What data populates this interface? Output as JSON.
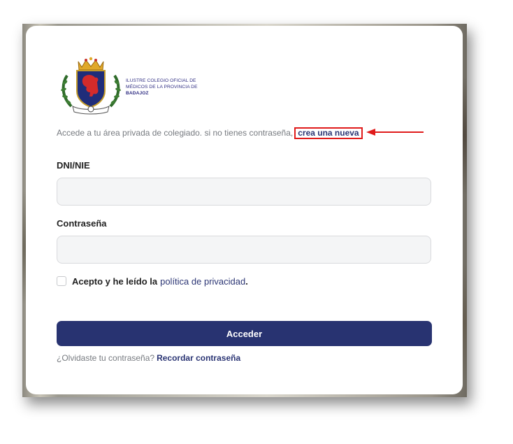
{
  "logo": {
    "line1": "ILUSTRE COLEGIO OFICIAL DE",
    "line2": "MÉDICOS DE LA PROVINCIA DE",
    "line3": "BADAJOZ"
  },
  "intro": {
    "text": "Accede a tu área privada de colegiado. si no tienes contraseña,",
    "create_link": "crea una nueva"
  },
  "form": {
    "dni_label": "DNI/NIE",
    "dni_value": "",
    "password_label": "Contraseña",
    "password_value": "",
    "accept_text": "Acepto y he leído la",
    "policy_link": "política de privacidad",
    "accept_suffix": ".",
    "accept_checked": false,
    "submit_label": "Acceder"
  },
  "forgot": {
    "text": "¿Olvidaste tu contraseña?",
    "link": "Recordar contraseña"
  },
  "colors": {
    "primary": "#283371",
    "link": "#2b3574",
    "highlight": "#e01b1b"
  },
  "icons": {
    "crest": "coat-of-arms-icon",
    "arrow": "red-arrow-icon"
  }
}
